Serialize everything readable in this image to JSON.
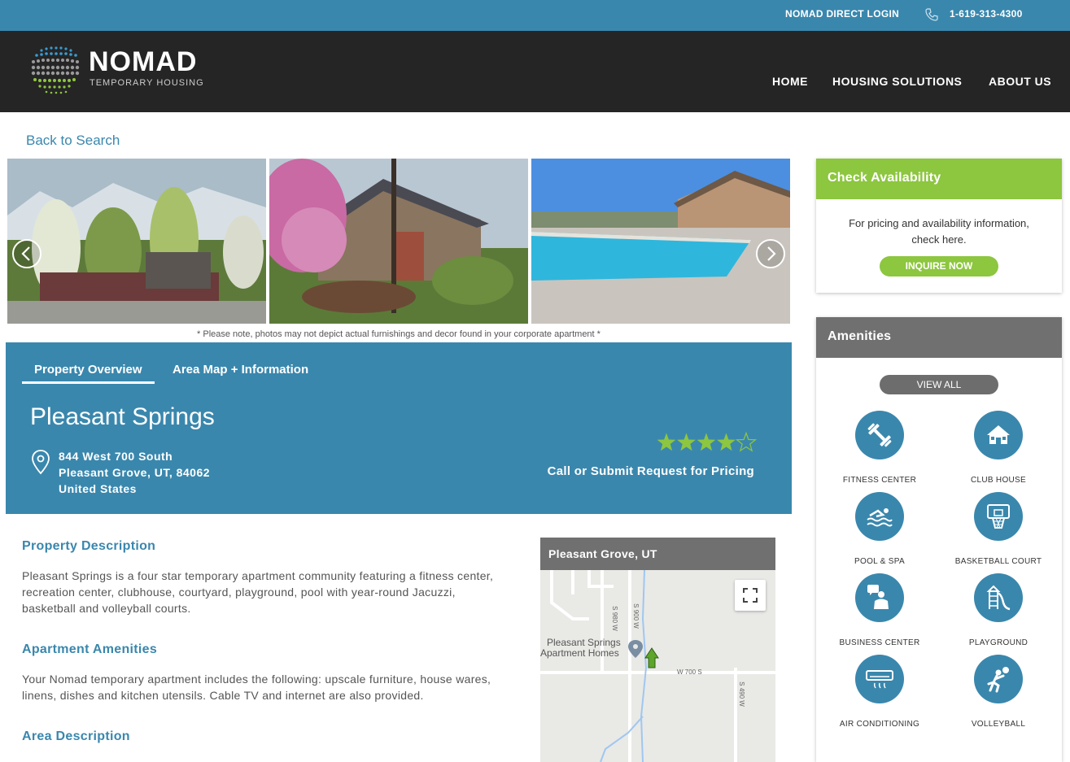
{
  "topbar": {
    "login": "NOMAD DIRECT LOGIN",
    "phone": "1-619-313-4300"
  },
  "brand": {
    "name": "NOMAD",
    "tagline": "TEMPORARY HOUSING"
  },
  "nav": {
    "home": "HOME",
    "housing": "HOUSING SOLUTIONS",
    "about": "ABOUT US"
  },
  "back_link": "Back to Search",
  "photo_note": "* Please note, photos may not depict actual furnishings and decor found in your corporate apartment *",
  "tabs": {
    "overview": "Property Overview",
    "area": "Area Map + Information"
  },
  "property": {
    "name": "Pleasant Springs",
    "address_line1": "844 West 700 South",
    "address_line2": "Pleasant Grove, UT, 84062",
    "address_line3": "United States",
    "rating": 4,
    "rating_max": 5,
    "pricing_note": "Call or Submit Request for Pricing"
  },
  "description": {
    "prop_heading": "Property Description",
    "prop_text": "Pleasant Springs is a four star temporary apartment community featuring a fitness center, recreation center, clubhouse, courtyard, playground, pool with year-round Jacuzzi, basketball and volleyball courts.",
    "amen_heading": "Apartment Amenities",
    "amen_text": "Your Nomad temporary apartment includes the following: upscale furniture, house wares, linens, dishes and kitchen utensils. Cable TV and internet are also provided.",
    "area_heading": "Area Description"
  },
  "map": {
    "title": "Pleasant Grove, UT",
    "pin_label_1": "Pleasant Springs",
    "pin_label_2": "Apartment Homes",
    "roads": {
      "r1": "S 980 W",
      "r2": "S 900 W",
      "r3": "W 700 S",
      "r4": "S 490 W"
    }
  },
  "availability": {
    "heading": "Check Availability",
    "line1": "For pricing and availability information,",
    "line2": "check here.",
    "button": "INQUIRE NOW"
  },
  "amenities": {
    "heading": "Amenities",
    "view_all": "VIEW ALL",
    "items": [
      "FITNESS CENTER",
      "CLUB HOUSE",
      "POOL & SPA",
      "BASKETBALL COURT",
      "BUSINESS CENTER",
      "PLAYGROUND",
      "AIR CONDITIONING",
      "VOLLEYBALL"
    ]
  },
  "colors": {
    "brand_blue": "#3a87ad",
    "green": "#8dc63f",
    "dark": "#252525",
    "gray_header": "#707070"
  }
}
